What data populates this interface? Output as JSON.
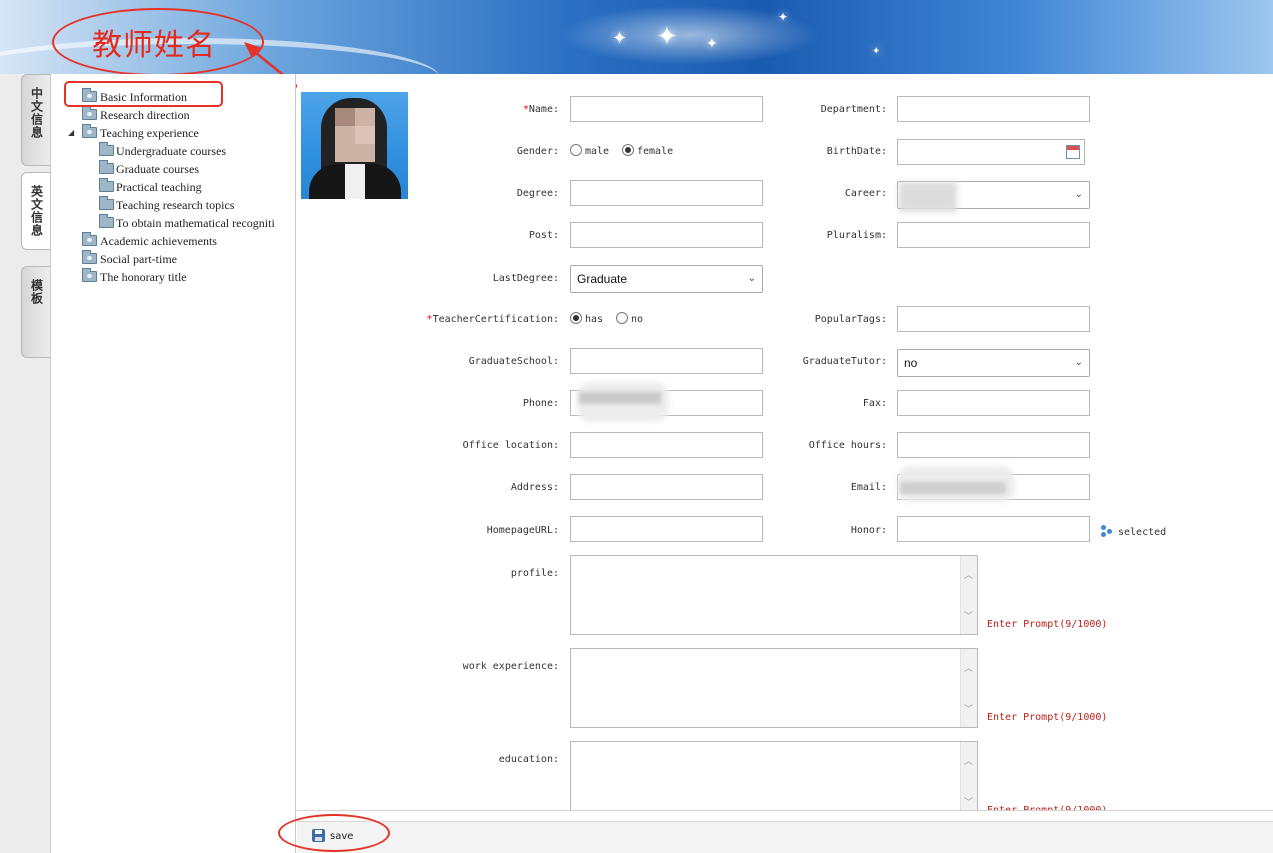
{
  "header": {
    "teacher_name": "教师姓名"
  },
  "vertical_tabs": [
    {
      "label": "中文信息",
      "active": false
    },
    {
      "label": "英文信息",
      "active": true
    },
    {
      "label": "模板",
      "active": false
    }
  ],
  "tree": {
    "items": [
      {
        "label": "Basic Information",
        "icon": "book-folder-icon",
        "level": 0
      },
      {
        "label": "Research direction",
        "icon": "book-folder-icon",
        "level": 0
      },
      {
        "label": "Teaching experience",
        "icon": "book-folder-icon",
        "level": 0,
        "expanded": true
      },
      {
        "label": "Undergraduate courses",
        "icon": "folder-icon",
        "level": 1
      },
      {
        "label": "Graduate courses",
        "icon": "folder-icon",
        "level": 1
      },
      {
        "label": "Practical teaching",
        "icon": "folder-icon",
        "level": 1
      },
      {
        "label": "Teaching research topics",
        "icon": "folder-icon",
        "level": 1
      },
      {
        "label": "To obtain mathematical recogniti",
        "icon": "folder-icon",
        "level": 1
      },
      {
        "label": "Academic achievements",
        "icon": "book-folder-icon",
        "level": 0
      },
      {
        "label": "Social part-time",
        "icon": "book-folder-icon",
        "level": 0
      },
      {
        "label": "The honorary title",
        "icon": "book-folder-icon",
        "level": 0
      }
    ]
  },
  "form": {
    "required_mark": "*",
    "name_label": "Name:",
    "department_label": "Department:",
    "gender_label": "Gender:",
    "gender_options": [
      "male",
      "female"
    ],
    "gender_selected": "female",
    "birthdate_label": "BirthDate:",
    "degree_label": "Degree:",
    "career_label": "Career:",
    "post_label": "Post:",
    "pluralism_label": "Pluralism:",
    "lastdegree_label": "LastDegree:",
    "lastdegree_value": "Graduate",
    "teachercert_label": "TeacherCertification:",
    "teachercert_options": [
      "has",
      "no"
    ],
    "teachercert_selected": "has",
    "populartags_label": "PopularTags:",
    "graduateschool_label": "GraduateSchool:",
    "graduatetutor_label": "GraduateTutor:",
    "graduatetutor_value": "no",
    "phone_label": "Phone:",
    "fax_label": "Fax:",
    "officelocation_label": "Office location:",
    "officehours_label": "Office hours:",
    "address_label": "Address:",
    "email_label": "Email:",
    "homepage_label": "HomepageURL:",
    "honor_label": "Honor:",
    "honor_selected_text": "selected",
    "profile_label": "profile:",
    "workexp_label": "work experience:",
    "education_label": "education:",
    "prompt_text": "Enter Prompt(9/1000)"
  },
  "footer": {
    "save_label": "save"
  }
}
